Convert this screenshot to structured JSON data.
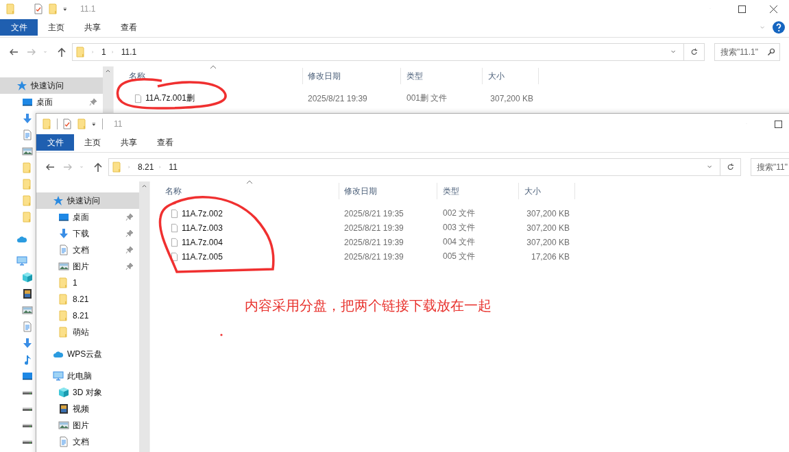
{
  "back_window": {
    "title": "11.1",
    "close_button": true,
    "help_button": true,
    "ribbon_tabs": [
      {
        "label": "文件",
        "selected": true
      },
      {
        "label": "主页",
        "selected": false
      },
      {
        "label": "共享",
        "selected": false
      },
      {
        "label": "查看",
        "selected": false
      }
    ],
    "address": {
      "path": [
        "1",
        "11.1"
      ]
    },
    "search": {
      "placeholder": "搜索\"11.1\""
    },
    "sidebar": [
      {
        "label": "快速访问",
        "kind": "star",
        "selected": true,
        "children": [
          {
            "label": "桌面",
            "kind": "desktop",
            "selected": false,
            "pinned": true
          },
          {
            "kind": "download",
            "selected": false
          },
          {
            "kind": "document",
            "selected": false
          },
          {
            "kind": "picture",
            "selected": false
          },
          {
            "kind": "folder",
            "selected": false
          },
          {
            "kind": "folder",
            "selected": false
          },
          {
            "kind": "folder",
            "selected": false
          },
          {
            "kind": "folder",
            "selected": false
          }
        ]
      },
      {
        "kind": "cloud",
        "selected": false
      },
      {
        "kind": "computer",
        "selected": false,
        "children": [
          {
            "kind": "cube",
            "selected": false
          },
          {
            "kind": "video",
            "selected": false
          },
          {
            "kind": "picture",
            "selected": false
          },
          {
            "kind": "document",
            "selected": false
          },
          {
            "kind": "download",
            "selected": false
          },
          {
            "kind": "music",
            "selected": false
          },
          {
            "kind": "desktop",
            "selected": false
          },
          {
            "kind": "drive",
            "selected": false
          },
          {
            "kind": "drive",
            "selected": false
          },
          {
            "kind": "drive",
            "selected": false
          },
          {
            "kind": "drive",
            "selected": false
          }
        ]
      }
    ],
    "table": {
      "columns": [
        "名称",
        "修改日期",
        "类型",
        "大小"
      ],
      "rows": [
        {
          "name": "11A.7z.001删",
          "modified": "2025/8/21 19:39",
          "type": "001删 文件",
          "size": "307,200 KB"
        }
      ]
    }
  },
  "front_window": {
    "title": "11",
    "qat_separators": true,
    "ribbon_tabs": [
      {
        "label": "文件",
        "selected": true
      },
      {
        "label": "主页",
        "selected": false
      },
      {
        "label": "共享",
        "selected": false
      },
      {
        "label": "查看",
        "selected": false
      }
    ],
    "address": {
      "path": [
        "8.21",
        "11"
      ]
    },
    "search": {
      "placeholder": "搜索\"11\""
    },
    "sidebar": [
      {
        "label": "快速访问",
        "kind": "star",
        "selected": true,
        "children": [
          {
            "label": "桌面",
            "kind": "desktop",
            "selected": false,
            "pinned": true
          },
          {
            "label": "下载",
            "kind": "download",
            "selected": false,
            "pinned": true
          },
          {
            "label": "文档",
            "kind": "document",
            "selected": false,
            "pinned": true
          },
          {
            "label": "图片",
            "kind": "picture",
            "selected": false,
            "pinned": true
          },
          {
            "label": "1",
            "kind": "folder",
            "selected": false,
            "pinned": false
          },
          {
            "label": "8.21",
            "kind": "folder",
            "selected": false,
            "pinned": false
          },
          {
            "label": "8.21",
            "kind": "folder",
            "selected": false,
            "pinned": false
          },
          {
            "label": "萌站",
            "kind": "folder",
            "selected": false,
            "pinned": false
          }
        ]
      },
      {
        "label": "WPS云盘",
        "kind": "cloud",
        "selected": false
      },
      {
        "label": "此电脑",
        "kind": "computer",
        "selected": false,
        "children": [
          {
            "label": "3D 对象",
            "kind": "cube",
            "selected": false
          },
          {
            "label": "视频",
            "kind": "video",
            "selected": false
          },
          {
            "label": "图片",
            "kind": "picture",
            "selected": false
          },
          {
            "label": "文档",
            "kind": "document",
            "selected": false
          }
        ]
      }
    ],
    "table": {
      "columns": [
        "名称",
        "修改日期",
        "类型",
        "大小"
      ],
      "rows": [
        {
          "name": "11A.7z.002",
          "modified": "2025/8/21 19:35",
          "type": "002 文件",
          "size": "307,200 KB"
        },
        {
          "name": "11A.7z.003",
          "modified": "2025/8/21 19:39",
          "type": "003 文件",
          "size": "307,200 KB"
        },
        {
          "name": "11A.7z.004",
          "modified": "2025/8/21 19:39",
          "type": "004 文件",
          "size": "307,200 KB"
        },
        {
          "name": "11A.7z.005",
          "modified": "2025/8/21 19:39",
          "type": "005 文件",
          "size": "17,206 KB"
        }
      ]
    }
  },
  "annotation": {
    "text": "内容采用分盘，把两个链接下载放在一起"
  }
}
